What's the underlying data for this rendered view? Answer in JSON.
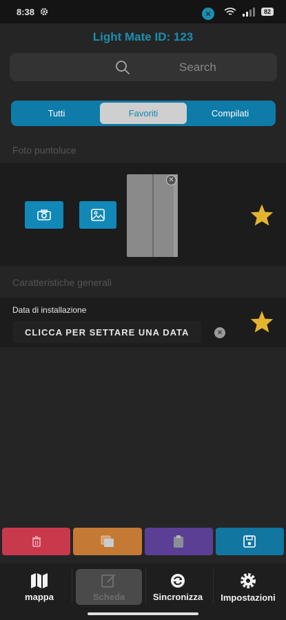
{
  "status_bar": {
    "time": "8:38",
    "battery": "82"
  },
  "header": {
    "title": "Light Mate ID: 123"
  },
  "search": {
    "placeholder": "Search"
  },
  "tabs": [
    {
      "label": "Tutti",
      "active": false
    },
    {
      "label": "Favoriti",
      "active": true
    },
    {
      "label": "Compilati",
      "active": false
    }
  ],
  "photo_section": {
    "title": "Foto puntoluce",
    "camera_icon": "camera-icon",
    "gallery_icon": "image-icon",
    "favorite": true
  },
  "general_section": {
    "title": "Caratteristiche generali",
    "install_date_label": "Data di installazione",
    "install_date_value": "CLICCA PER SETTARE UNA DATA",
    "favorite": true
  },
  "actions": [
    {
      "icon": "trash-icon",
      "color": "#c8394c"
    },
    {
      "icon": "copy-icon",
      "color": "#c47a34"
    },
    {
      "icon": "clipboard-icon",
      "color": "#5b3f94"
    },
    {
      "icon": "save-icon",
      "color": "#1176a0"
    }
  ],
  "bottom_nav": [
    {
      "label": "mappa",
      "icon": "map-icon",
      "active": false
    },
    {
      "label": "Scheda",
      "icon": "edit-icon",
      "active": true
    },
    {
      "label": "Sincronizza",
      "icon": "sync-icon",
      "active": false
    },
    {
      "label": "Impostazioni",
      "icon": "gear-icon",
      "active": false
    }
  ],
  "colors": {
    "accent": "#1188b8",
    "star": "#e3b52f",
    "background": "#252525"
  }
}
